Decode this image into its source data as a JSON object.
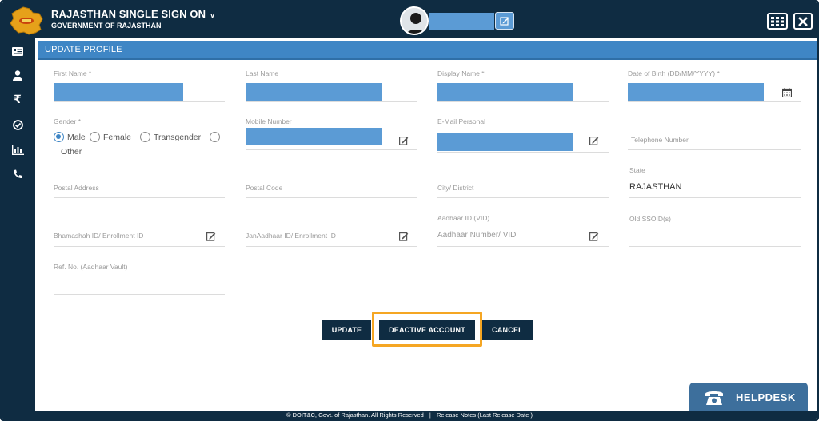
{
  "header": {
    "title": "RAJASTHAN SINGLE SIGN ON",
    "title_caret": "v",
    "subtitle": "GOVERNMENT OF RAJASTHAN"
  },
  "panel": {
    "title": "UPDATE PROFILE"
  },
  "form": {
    "first_name_label": "First Name *",
    "last_name_label": "Last Name",
    "display_name_label": "Display Name *",
    "dob_label": "Date of Birth (DD/MM/YYYY) *",
    "gender_label": "Gender *",
    "gender_options": [
      "Male",
      "Female",
      "Transgender",
      "Other"
    ],
    "gender_selected": "Male",
    "mobile_label": "Mobile Number",
    "email_label": "E-Mail Personal",
    "telephone_placeholder": "Telephone Number",
    "postal_address_placeholder": "Postal Address",
    "postal_code_placeholder": "Postal Code",
    "city_placeholder": "City/ District",
    "state_label": "State",
    "state_value": "RAJASTHAN",
    "bhamashah_placeholder": "Bhamashah ID/ Enrollment ID",
    "janaadhaar_placeholder": "JanAadhaar ID/ Enrollment ID",
    "aadhaar_label": "Aadhaar ID (VID)",
    "aadhaar_placeholder": "Aadhaar Number/ VID",
    "old_ssoid_placeholder": "Old SSOID(s)",
    "ref_no_placeholder": "Ref. No. (Aadhaar Vault)"
  },
  "buttons": {
    "update": "UPDATE",
    "deactivate": "DEACTIVE ACCOUNT",
    "cancel": "CANCEL"
  },
  "footer": {
    "copyright": "© DOIT&C, Govt. of Rajasthan. All Rights Reserved",
    "separator": "|",
    "release_notes": "Release Notes (Last Release Date )"
  },
  "helpdesk": {
    "label": "HELPDESK"
  },
  "colors": {
    "nav_dark": "#0f2c42",
    "panel_blue": "#3f86c5",
    "field_blue": "#5b9bd5",
    "highlight_orange": "#f5a623"
  }
}
